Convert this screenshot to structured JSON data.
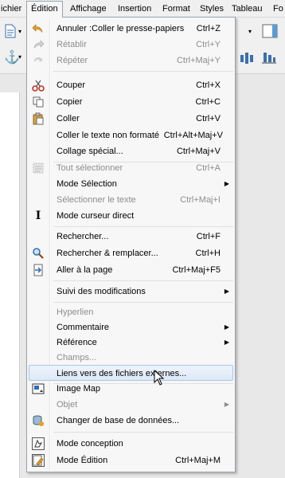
{
  "menubar": {
    "items": [
      {
        "label": "ichier",
        "active": false
      },
      {
        "label": "Édition",
        "active": true
      },
      {
        "label": "Affichage",
        "active": false
      },
      {
        "label": "Insertion",
        "active": false
      },
      {
        "label": "Format",
        "active": false
      },
      {
        "label": "Styles",
        "active": false
      },
      {
        "label": "Tableau",
        "active": false
      },
      {
        "label": "Fo",
        "active": false
      }
    ]
  },
  "menu": {
    "items": [
      {
        "label": "Annuler :Coller le presse-papiers",
        "shortcut": "Ctrl+Z",
        "icon": "undo-icon",
        "enabled": true
      },
      {
        "label": "Rétablir",
        "shortcut": "Ctrl+Y",
        "icon": "redo-icon",
        "enabled": false
      },
      {
        "label": "Répéter",
        "shortcut": "Ctrl+Maj+Y",
        "icon": "repeat-icon",
        "enabled": false
      },
      {
        "label": "Couper",
        "shortcut": "Ctrl+X",
        "icon": "cut-icon",
        "enabled": true
      },
      {
        "label": "Copier",
        "shortcut": "Ctrl+C",
        "icon": "copy-icon",
        "enabled": true
      },
      {
        "label": "Coller",
        "shortcut": "Ctrl+V",
        "icon": "paste-icon",
        "enabled": true
      },
      {
        "label": "Coller le texte non formaté",
        "shortcut": "Ctrl+Alt+Maj+V",
        "icon": "",
        "enabled": true
      },
      {
        "label": "Collage spécial...",
        "shortcut": "Ctrl+Maj+V",
        "icon": "",
        "enabled": true
      },
      {
        "label": "Tout sélectionner",
        "shortcut": "Ctrl+A",
        "icon": "select-all-icon",
        "enabled": false
      },
      {
        "label": "Mode Sélection",
        "shortcut": "",
        "icon": "",
        "enabled": true,
        "submenu": true
      },
      {
        "label": "Sélectionner le texte",
        "shortcut": "Ctrl+Maj+I",
        "icon": "",
        "enabled": false
      },
      {
        "label": "Mode curseur direct",
        "shortcut": "",
        "icon": "text-cursor-icon",
        "enabled": true
      },
      {
        "label": "Rechercher...",
        "shortcut": "Ctrl+F",
        "icon": "",
        "enabled": true
      },
      {
        "label": "Rechercher & remplacer...",
        "shortcut": "Ctrl+H",
        "icon": "find-replace-icon",
        "enabled": true
      },
      {
        "label": "Aller à la page",
        "shortcut": "Ctrl+Maj+F5",
        "icon": "goto-page-icon",
        "enabled": true
      },
      {
        "label": "Suivi des modifications",
        "shortcut": "",
        "icon": "",
        "enabled": true,
        "submenu": true
      },
      {
        "label": "Hyperlien",
        "shortcut": "",
        "icon": "",
        "enabled": false
      },
      {
        "label": "Commentaire",
        "shortcut": "",
        "icon": "",
        "enabled": true,
        "submenu": true
      },
      {
        "label": "Référence",
        "shortcut": "",
        "icon": "",
        "enabled": true,
        "submenu": true
      },
      {
        "label": "Champs...",
        "shortcut": "",
        "icon": "",
        "enabled": false
      },
      {
        "label": "Liens vers des fichiers externes...",
        "shortcut": "",
        "icon": "",
        "enabled": true,
        "highlighted": true
      },
      {
        "label": "Image Map",
        "shortcut": "",
        "icon": "image-map-icon",
        "enabled": true
      },
      {
        "label": "Objet",
        "shortcut": "",
        "icon": "",
        "enabled": false,
        "submenu": true
      },
      {
        "label": "Changer de base de données...",
        "shortcut": "",
        "icon": "database-icon",
        "enabled": true
      },
      {
        "label": "Mode conception",
        "shortcut": "",
        "icon": "design-mode-icon",
        "enabled": true
      },
      {
        "label": "Mode Édition",
        "shortcut": "Ctrl+Maj+M",
        "icon": "edit-mode-icon",
        "enabled": true
      }
    ]
  }
}
